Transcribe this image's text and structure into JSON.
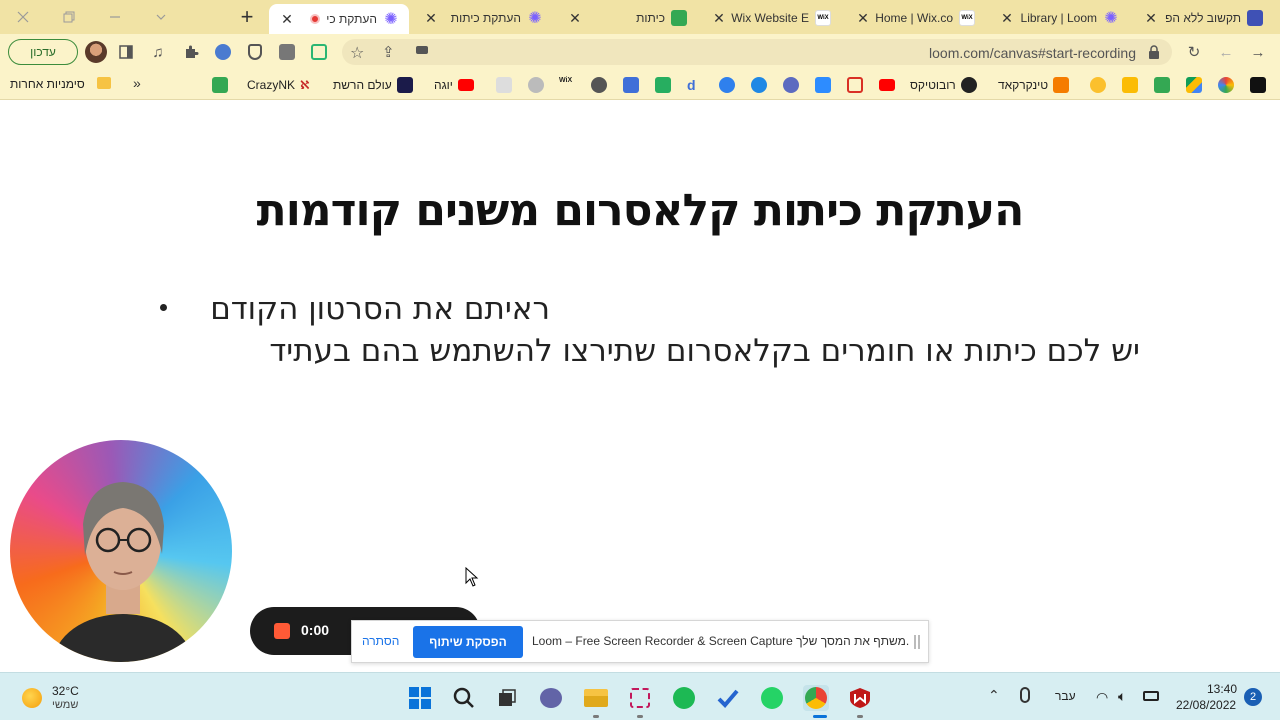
{
  "browser": {
    "tabs": [
      {
        "title": "תקשוב ללא הפ",
        "favicon": "board-icon"
      },
      {
        "title": "Library | Loom",
        "favicon": "loom-icon"
      },
      {
        "title": "Home | Wix.co",
        "favicon": "wix-icon"
      },
      {
        "title": "Wix Website E",
        "favicon": "wix-icon"
      },
      {
        "title": "כיתות",
        "favicon": "classroom-icon"
      },
      {
        "title": "העתקת כיתות",
        "favicon": "loom-icon"
      },
      {
        "title": "העתקת כי",
        "favicon": "recording-icon",
        "active": true
      }
    ],
    "url": "loom.com/canvas#start-recording",
    "profile_label": "עדכון",
    "bookmarks": [
      {
        "label": "טינקרקאד"
      },
      {
        "label": "רובוטיקס"
      },
      {
        "label": "יוגה"
      },
      {
        "label": "עולם הרשת"
      },
      {
        "label": "CrazyNK"
      }
    ],
    "other_bookmarks": "סימניות אחרות",
    "more_bookmarks": "»"
  },
  "slide": {
    "title": "העתקת כיתות קלאסרום משנים קודמות",
    "bullets": [
      "ראיתם את הסרטון הקודם",
      "יש לכם כיתות או חומרים בקלאסרום שתירצו להשתמש בהם בעתיד"
    ]
  },
  "recorder": {
    "timer": "0:00"
  },
  "share_banner": {
    "message": "Loom – Free Screen Recorder & Screen Capture משתף את המסך שלך.",
    "stop_label": "הפסקת שיתוף",
    "hide_label": "הסתרה"
  },
  "taskbar": {
    "temperature": "32°C",
    "weather": "שמשי",
    "language": "עבר",
    "time": "13:40",
    "date": "22/08/2022",
    "notifications": "2"
  }
}
